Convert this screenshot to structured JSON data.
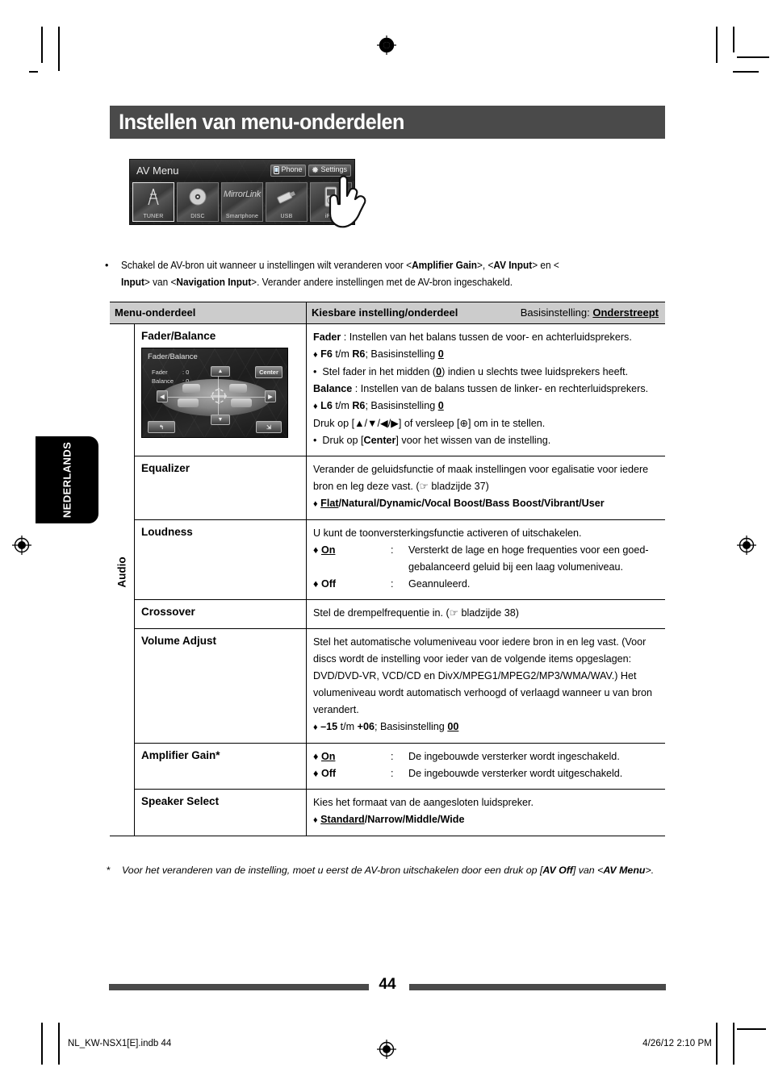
{
  "page": {
    "title": "Instellen van menu-onderdelen",
    "number": "44",
    "language_tab": "NEDERLANDS"
  },
  "device_screenshot": {
    "header_title": "AV Menu",
    "buttons": [
      {
        "label": "Phone",
        "icon": "phone-icon"
      },
      {
        "label": "Settings",
        "icon": "gear-icon"
      }
    ],
    "tiles": [
      {
        "label": "TUNER",
        "icon": "antenna-icon",
        "selected": true
      },
      {
        "label": "DISC",
        "icon": "disc-icon",
        "selected": false
      },
      {
        "label": "Smartphone",
        "icon": "mirrorlink-logo",
        "brand": "MirrorLink",
        "selected": false
      },
      {
        "label": "USB",
        "icon": "usb-stick-icon",
        "selected": false
      },
      {
        "label": "iPod",
        "icon": "ipod-icon",
        "selected": false
      }
    ],
    "cursor": "pointing-hand-cursor"
  },
  "intro_note": {
    "bullet": "•",
    "part1": "Schakel de AV-bron uit wanneer u instellingen wilt veranderen voor <",
    "bold1": "Amplifier Gain",
    "part2": ">, <",
    "bold2": "AV Input",
    "part3": "> en <",
    "bold3": "Input",
    "part4": "> van <",
    "bold4": "Navigation Input",
    "part5": ">. Verander andere instellingen met de AV-bron ingeschakeld."
  },
  "table": {
    "headers": {
      "menu_item": "Menu-onderdeel",
      "selectable": "Kiesbare instelling/onderdeel",
      "default_prefix": "Basisinstelling: ",
      "default_bold": "Onderstreept"
    },
    "group_label": "Audio",
    "rows": [
      {
        "name": "Fader/Balance",
        "image": {
          "title": "Fader/Balance",
          "fader_key": "Fader",
          "fader_value": ": 0",
          "balance_key": "Balance",
          "balance_value": ": 0",
          "center_button": "Center"
        },
        "lines": [
          {
            "type": "lead",
            "bold": "Fader",
            "rest": " : Instellen van het balans tussen de voor- en achterluidsprekers."
          },
          {
            "type": "diamond",
            "bold": "F6",
            "mid": " t/m ",
            "bold2": "R6",
            "rest": "; Basisinstelling ",
            "underline": "0"
          },
          {
            "type": "bullet",
            "text": "Stel fader in het midden (0) indien u slechts twee luidsprekers heeft."
          },
          {
            "type": "lead",
            "bold": "Balance",
            "rest": " : Instellen van de balans tussen de linker- en rechterluidsprekers."
          },
          {
            "type": "diamond",
            "bold": "L6",
            "mid": " t/m ",
            "bold2": "R6",
            "rest": "; Basisinstelling ",
            "underline": "0"
          },
          {
            "type": "plain",
            "text": "Druk op [▲/▼/◀/▶] of versleep [⊕] om in te stellen."
          },
          {
            "type": "bullet_bold",
            "pre": "Druk op [",
            "bold": "Center",
            "post": "] voor het wissen van de instelling."
          }
        ]
      },
      {
        "name": "Equalizer",
        "lines": [
          {
            "type": "plain",
            "text": "Verander de geluidsfunctie of maak instellingen voor egalisatie voor iedere"
          },
          {
            "type": "plain",
            "text": "bron en leg deze vast. (☞ bladzijde 37)"
          },
          {
            "type": "diamond_options",
            "underline_first": "Flat",
            "rest": "/Natural/Dynamic/Vocal Boost/Bass Boost/Vibrant/User"
          }
        ]
      },
      {
        "name": "Loudness",
        "lines": [
          {
            "type": "plain",
            "text": "U kunt de toonversterkingsfunctie activeren of uitschakelen."
          },
          {
            "type": "optrow",
            "label": "On",
            "underline": true,
            "colon": ":",
            "text": "Versterkt de lage en hoge frequenties voor een goed-"
          },
          {
            "type": "controw",
            "text": "gebalanceerd geluid bij een laag volumeniveau."
          },
          {
            "type": "optrow",
            "label": "Off",
            "underline": false,
            "colon": ":",
            "text": "Geannuleerd."
          }
        ]
      },
      {
        "name": "Crossover",
        "lines": [
          {
            "type": "plain",
            "text": "Stel de drempelfrequentie in. (☞ bladzijde 38)"
          }
        ]
      },
      {
        "name": "Volume Adjust",
        "lines": [
          {
            "type": "plain",
            "text": "Stel het automatische volumeniveau voor iedere bron in en leg vast. (Voor"
          },
          {
            "type": "plain",
            "text": "discs wordt de instelling voor ieder van de volgende items opgeslagen:"
          },
          {
            "type": "plain",
            "text": "DVD/DVD-VR, VCD/CD en DivX/MPEG1/MPEG2/MP3/WMA/WAV.) Het"
          },
          {
            "type": "plain",
            "text": "volumeniveau wordt automatisch verhoogd of verlaagd wanneer u van bron"
          },
          {
            "type": "plain",
            "text": "verandert."
          },
          {
            "type": "diamond",
            "bold": "–15",
            "mid": " t/m ",
            "bold2": "+06",
            "rest": "; Basisinstelling ",
            "underline": "00"
          }
        ]
      },
      {
        "name": "Amplifier Gain*",
        "lines": [
          {
            "type": "optrow",
            "label": "On",
            "underline": true,
            "colon": ":",
            "text": "De ingebouwde versterker wordt ingeschakeld."
          },
          {
            "type": "optrow",
            "label": "Off",
            "underline": false,
            "colon": ":",
            "text": "De ingebouwde versterker wordt uitgeschakeld."
          }
        ]
      },
      {
        "name": "Speaker Select",
        "lines": [
          {
            "type": "plain",
            "text": "Kies het formaat van de aangesloten luidspreker."
          },
          {
            "type": "diamond_options",
            "underline_first": "Standard",
            "rest": "/Narrow/Middle/Wide"
          }
        ]
      }
    ]
  },
  "footnote": {
    "marker": "*",
    "part1": "Voor het veranderen van de instelling, moet u eerst de AV-bron uitschakelen door een druk op [",
    "bold1": "AV Off",
    "part2": "] van <",
    "bold2": "AV Menu",
    "part3": ">."
  },
  "printer_footer": {
    "filename": "NL_KW-NSX1[E].indb   44",
    "timestamp": "4/26/12   2:10 PM"
  },
  "colors": {
    "title_banner": "#4a4a4a",
    "table_header": "#cccccc",
    "rule": "#4a4a4a",
    "tab": "#000000"
  }
}
